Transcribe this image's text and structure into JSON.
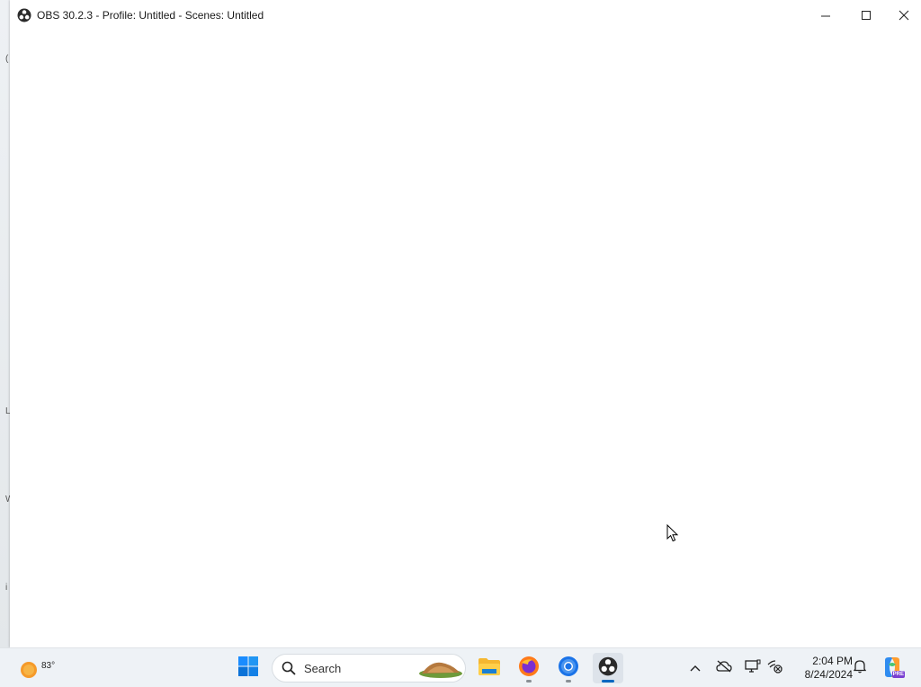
{
  "window": {
    "title": "OBS 30.2.3 - Profile: Untitled - Scenes: Untitled",
    "controls": {
      "minimize_icon": "minimize-icon",
      "maximize_icon": "maximize-icon",
      "close_icon": "close-icon"
    }
  },
  "desktop": {
    "partial_glyphs": [
      "(",
      "L",
      "W",
      "i"
    ]
  },
  "taskbar": {
    "weather": {
      "temperature": "83°",
      "icon": "sun-icon"
    },
    "search": {
      "label": "Search"
    },
    "pinned_apps": [
      {
        "name": "Start",
        "icon": "windows-logo-icon"
      },
      {
        "name": "File Explorer",
        "icon": "folder-icon"
      },
      {
        "name": "Firefox",
        "icon": "firefox-icon"
      },
      {
        "name": "Chrome",
        "icon": "chrome-icon"
      },
      {
        "name": "OBS Studio",
        "icon": "obs-icon",
        "active": true
      }
    ],
    "tray": {
      "items": [
        "chevron-up-icon",
        "cloud-offline-icon",
        "display-icon",
        "network-settings-icon"
      ],
      "time": "2:04 PM",
      "date": "8/24/2024",
      "notification_icon": "bell-icon",
      "copilot_icon": "copilot-pre-icon",
      "copilot_badge": "PRE"
    }
  },
  "colors": {
    "taskbar_bg": "#eef2f6",
    "accent": "#0067c0",
    "window_bg": "#ffffff"
  }
}
